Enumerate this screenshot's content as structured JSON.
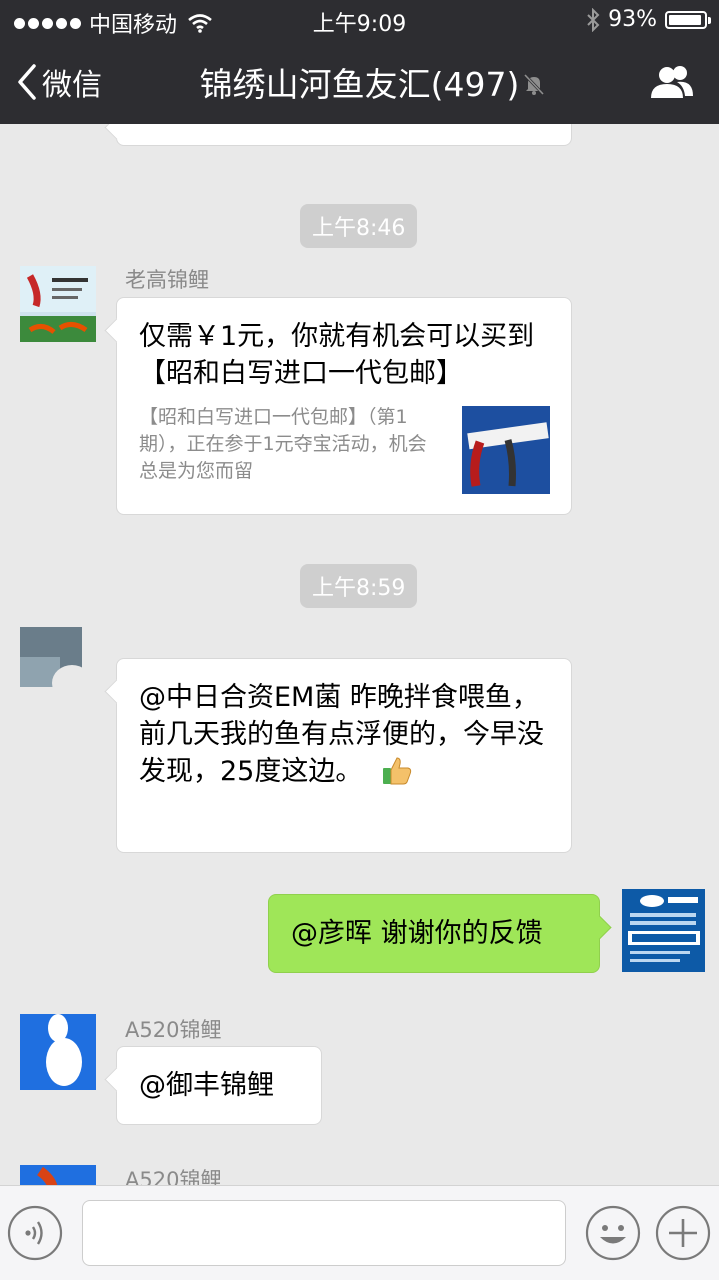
{
  "status_bar": {
    "carrier": "中国移动",
    "time": "上午9:09",
    "battery": "93%",
    "battery_level": 0.93
  },
  "nav": {
    "back_label": "微信",
    "title": "锦绣山河鱼友汇(497)"
  },
  "messages": {
    "time1": "上午8:46",
    "m1": {
      "sender": "老高锦鲤",
      "title": "仅需￥1元，你就有机会可以买到【昭和白写进口一代包邮】",
      "desc": "【昭和白写进口一代包邮】（第1 期），正在参于1元夺宝活动，机会总是为您而留"
    },
    "time2": "上午8:59",
    "m2": {
      "text": "@中日合资EM菌 昨晚拌食喂鱼，前几天我的鱼有点浮便的，今早没发现，25度这边。"
    },
    "m3": {
      "text": "@彦晖 谢谢你的反馈"
    },
    "m4": {
      "sender": "A520锦鲤",
      "text": "@御丰锦鲤"
    },
    "m5": {
      "sender": "A520锦鲤"
    }
  },
  "toolbar": {
    "input_placeholder": ""
  },
  "icons": {
    "back": "chevron-left-icon",
    "mute": "mute-bell-icon",
    "group": "group-members-icon",
    "voice": "voice-icon",
    "emoji": "emoji-icon",
    "plus": "plus-icon",
    "thumbs_up": "thumbs-up-emoji"
  },
  "colors": {
    "nav_bg": "#2d2d31",
    "chat_bg": "#e9e9e9",
    "sent_bubble": "#9fe658",
    "received_bubble": "#ffffff"
  }
}
